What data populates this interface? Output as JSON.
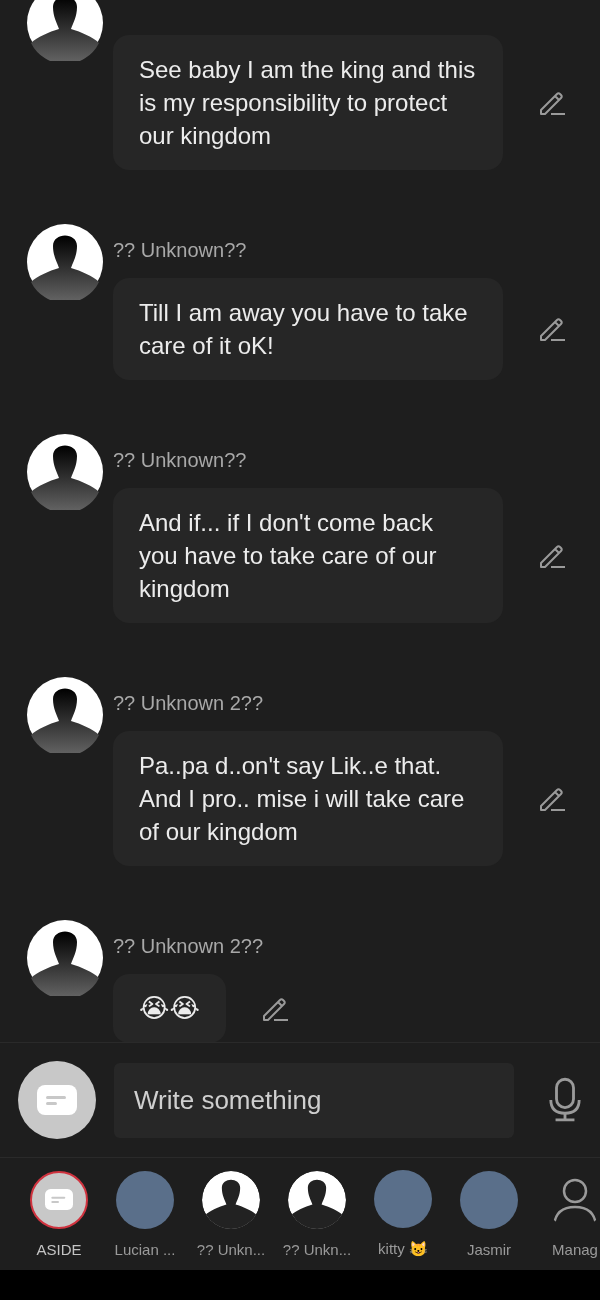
{
  "messages": [
    {
      "text": "See baby I am the king and this is my responsibility to protect our kingdom",
      "kind": "text"
    },
    {
      "name": "?? Unknown??",
      "text": "Till I am away you have to take care of it oK!",
      "kind": "text"
    },
    {
      "name": "?? Unknown??",
      "text": "And if... if I don't come back  you have to take care of our kingdom",
      "kind": "text"
    },
    {
      "name": "?? Unknown 2??",
      "text": "Pa..pa d..on't say Lik..e that. And I pro.. mise i will take care of our kingdom",
      "kind": "text"
    },
    {
      "name": "?? Unknown 2??",
      "text": "😭😭",
      "kind": "emoji"
    }
  ],
  "composer": {
    "placeholder": "Write something"
  },
  "characters": [
    {
      "label": "ASIDE",
      "kind": "aside",
      "selected": true
    },
    {
      "label": "Lucian ...",
      "kind": "photo",
      "selected": false
    },
    {
      "label": "?? Unkn...",
      "kind": "silhouette",
      "selected": false
    },
    {
      "label": "?? Unkn...",
      "kind": "silhouette",
      "selected": false
    },
    {
      "label": "kitty 😺",
      "kind": "photo",
      "selected": false
    },
    {
      "label": "Jasmir",
      "kind": "photo",
      "selected": false
    },
    {
      "label": "Manag",
      "kind": "outline",
      "selected": false
    }
  ]
}
